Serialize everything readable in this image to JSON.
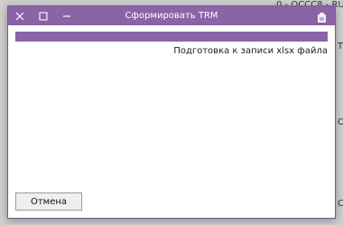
{
  "window": {
    "title": "Сформировать TRM",
    "status": "Подготовка к записи xlsx файла",
    "progress_percent": 100,
    "cancel_label": "Отмена"
  },
  "background": {
    "text_line_1": "0 - ОССС8 - RU",
    "text_line_2": "T",
    "text_line_3": "O",
    "text_line_4": "C"
  },
  "colors": {
    "accent": "#8a64a6",
    "progress_track": "#e6e6e6"
  },
  "icons": {
    "close": "close-icon",
    "maximize": "maximize-icon",
    "minimize": "minimize-icon",
    "app": "app-icon"
  }
}
